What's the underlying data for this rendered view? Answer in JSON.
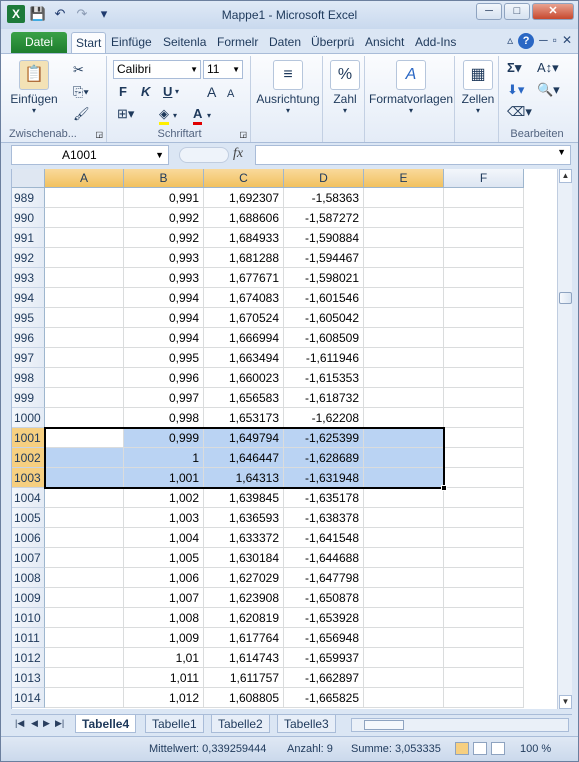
{
  "window": {
    "title": "Mappe1  -  Microsoft Excel",
    "min": "─",
    "max": "□",
    "close": "✕"
  },
  "qat": {
    "app_icon": "X",
    "save": "💾",
    "undo": "↶",
    "redo": "↷",
    "customize": "▾"
  },
  "tabs": [
    "Datei",
    "Start",
    "Einfüge",
    "Seitenla",
    "Formelr",
    "Daten",
    "Überprü",
    "Ansicht",
    "Add-Ins"
  ],
  "ribbon": {
    "clipboard": {
      "paste": "Einfügen",
      "label": "Zwischenab..."
    },
    "font": {
      "name": "Calibri",
      "size": "11",
      "bold": "F",
      "italic": "K",
      "underline": "U",
      "grow": "A",
      "shrink": "A",
      "color_letter": "A",
      "label": "Schriftart"
    },
    "alignment": {
      "label": "Ausrichtung"
    },
    "number": {
      "label": "Zahl",
      "icon": "%"
    },
    "styles": {
      "label": "Formatvorlagen",
      "icon": "A"
    },
    "cells": {
      "label": "Zellen"
    },
    "editing": {
      "label": "Bearbeiten",
      "sum_icon": "Σ"
    }
  },
  "formula_bar": {
    "name_box": "A1001",
    "fx": "fx",
    "value": ""
  },
  "columns": [
    "A",
    "B",
    "C",
    "D",
    "E",
    "F"
  ],
  "rows": [
    {
      "n": "989",
      "b": "0,991",
      "c": "1,692307",
      "d": "-1,58363"
    },
    {
      "n": "990",
      "b": "0,992",
      "c": "1,688606",
      "d": "-1,587272"
    },
    {
      "n": "991",
      "b": "0,992",
      "c": "1,684933",
      "d": "-1,590884"
    },
    {
      "n": "992",
      "b": "0,993",
      "c": "1,681288",
      "d": "-1,594467"
    },
    {
      "n": "993",
      "b": "0,993",
      "c": "1,677671",
      "d": "-1,598021"
    },
    {
      "n": "994",
      "b": "0,994",
      "c": "1,674083",
      "d": "-1,601546"
    },
    {
      "n": "995",
      "b": "0,994",
      "c": "1,670524",
      "d": "-1,605042"
    },
    {
      "n": "996",
      "b": "0,994",
      "c": "1,666994",
      "d": "-1,608509"
    },
    {
      "n": "997",
      "b": "0,995",
      "c": "1,663494",
      "d": "-1,611946"
    },
    {
      "n": "998",
      "b": "0,996",
      "c": "1,660023",
      "d": "-1,615353"
    },
    {
      "n": "999",
      "b": "0,997",
      "c": "1,656583",
      "d": "-1,618732"
    },
    {
      "n": "1000",
      "b": "0,998",
      "c": "1,653173",
      "d": "-1,62208"
    },
    {
      "n": "1001",
      "b": "0,999",
      "c": "1,649794",
      "d": "-1,625399"
    },
    {
      "n": "1002",
      "b": "1",
      "c": "1,646447",
      "d": "-1,628689"
    },
    {
      "n": "1003",
      "b": "1,001",
      "c": "1,64313",
      "d": "-1,631948"
    },
    {
      "n": "1004",
      "b": "1,002",
      "c": "1,639845",
      "d": "-1,635178"
    },
    {
      "n": "1005",
      "b": "1,003",
      "c": "1,636593",
      "d": "-1,638378"
    },
    {
      "n": "1006",
      "b": "1,004",
      "c": "1,633372",
      "d": "-1,641548"
    },
    {
      "n": "1007",
      "b": "1,005",
      "c": "1,630184",
      "d": "-1,644688"
    },
    {
      "n": "1008",
      "b": "1,006",
      "c": "1,627029",
      "d": "-1,647798"
    },
    {
      "n": "1009",
      "b": "1,007",
      "c": "1,623908",
      "d": "-1,650878"
    },
    {
      "n": "1010",
      "b": "1,008",
      "c": "1,620819",
      "d": "-1,653928"
    },
    {
      "n": "1011",
      "b": "1,009",
      "c": "1,617764",
      "d": "-1,656948"
    },
    {
      "n": "1012",
      "b": "1,01",
      "c": "1,614743",
      "d": "-1,659937"
    },
    {
      "n": "1013",
      "b": "1,011",
      "c": "1,611757",
      "d": "-1,662897"
    },
    {
      "n": "1014",
      "b": "1,012",
      "c": "1,608805",
      "d": "-1,665825"
    }
  ],
  "selected_rows": [
    "1001",
    "1002",
    "1003"
  ],
  "sheet_tabs": [
    "Tabelle4",
    "Tabelle1",
    "Tabelle2",
    "Tabelle3"
  ],
  "active_sheet": "Tabelle4",
  "status": {
    "average": "Mittelwert: 0,339259444",
    "count": "Anzahl: 9",
    "sum": "Summe: 3,053335",
    "zoom": "100 %"
  },
  "colors": {
    "accent": "#1d7a3a",
    "selection": "#bad3f3",
    "header_selected": "#f6cf80"
  }
}
